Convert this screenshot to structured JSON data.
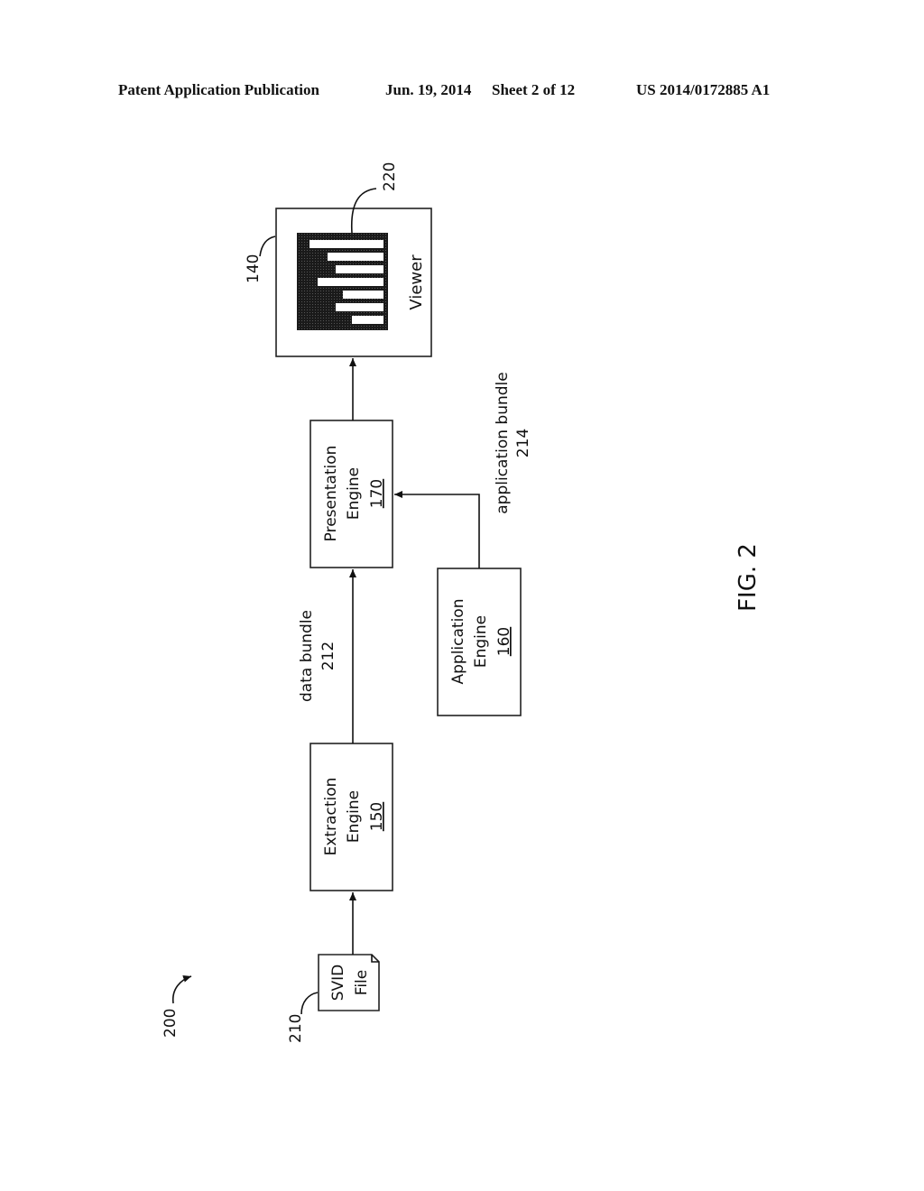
{
  "header": {
    "publication": "Patent Application Publication",
    "date": "Jun. 19, 2014",
    "sheet": "Sheet 2 of 12",
    "number": "US 2014/0172885 A1"
  },
  "figure": {
    "caption": "FIG. 2",
    "ref": "200",
    "nodes": {
      "svid_file": {
        "line1": "SVID",
        "line2": "File",
        "ref": "210"
      },
      "extraction": {
        "line1": "Extraction",
        "line2": "Engine",
        "ref": "150"
      },
      "presentation": {
        "line1": "Presentation",
        "line2": "Engine",
        "ref": "170"
      },
      "application": {
        "line1": "Application",
        "line2": "Engine",
        "ref": "160"
      },
      "viewer": {
        "label": "Viewer",
        "ref": "140",
        "display_ref": "220"
      }
    },
    "edges": {
      "data_bundle": {
        "label": "data bundle",
        "ref": "212"
      },
      "application_bundle": {
        "label": "application bundle",
        "ref": "214"
      }
    }
  }
}
